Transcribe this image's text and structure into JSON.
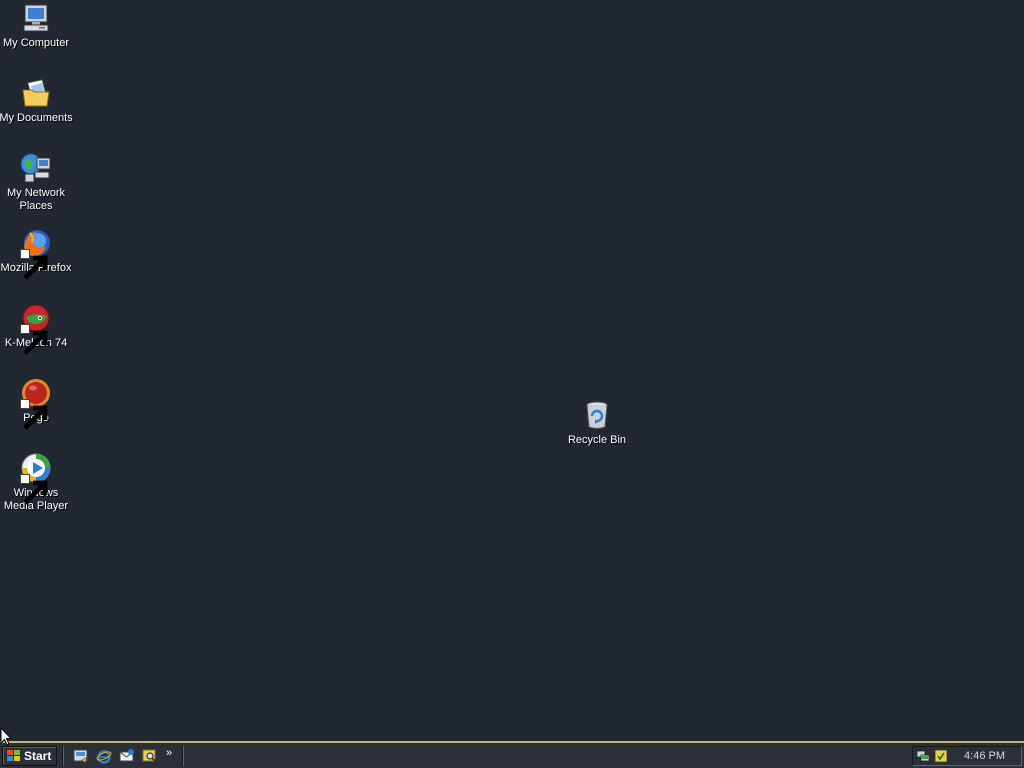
{
  "desktop": {
    "icons": [
      {
        "label": "My Computer",
        "icon": "computer-icon"
      },
      {
        "label": "My Documents",
        "icon": "documents-folder-icon"
      },
      {
        "label": "My Network\nPlaces",
        "icon": "network-places-icon"
      },
      {
        "label": "Mozilla Firefox",
        "icon": "firefox-icon",
        "shortcut": true
      },
      {
        "label": "K-Meleon 74",
        "icon": "kmeleon-icon",
        "shortcut": true
      },
      {
        "label": "Pego",
        "icon": "pego-icon",
        "shortcut": true
      },
      {
        "label": "Windows\nMedia Player",
        "icon": "media-player-icon",
        "shortcut": true
      },
      {
        "label": "Recycle Bin",
        "icon": "recycle-bin-icon"
      }
    ],
    "background_color": "#222831"
  },
  "taskbar": {
    "start_label": "Start",
    "quick_launch": [
      {
        "icon": "show-desktop-icon"
      },
      {
        "icon": "internet-explorer-icon"
      },
      {
        "icon": "outlook-express-icon"
      },
      {
        "icon": "search-explorer-icon"
      }
    ],
    "chevron": "»",
    "tray_icons": [
      {
        "icon": "network-tray-icon"
      },
      {
        "icon": "security-tray-icon"
      }
    ],
    "clock": "4:46 PM",
    "accent_color": "#c2b47a"
  }
}
